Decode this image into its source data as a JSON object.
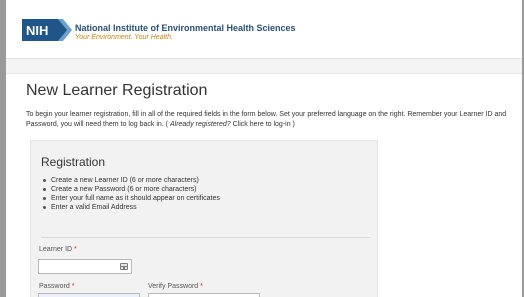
{
  "header": {
    "logo_text": "NIH",
    "org_name": "National Institute of Environmental Health Sciences",
    "tagline": "Your Environment. Your Health."
  },
  "page": {
    "title": "New Learner Registration",
    "intro_part1": "To begin your learner registration, fill in all of the required fields in the form below. Set your preferred language on the right. Remember your Learner ID and Password, you will need them to log back in. (",
    "intro_already": "Already registered?",
    "intro_part2": "Click here to log-in",
    "intro_end": ")"
  },
  "registration": {
    "title": "Registration",
    "requirements": [
      "Create a new Learner ID (6 or more characters)",
      "Create a new Password (6 or more characters)",
      "Enter your full name as it should appear on certificates",
      "Enter a valid Email Address"
    ],
    "learner_id_label": "Learner ID",
    "learner_id_value": "",
    "password_label": "Password",
    "password_value": "",
    "verify_password_label": "Verify Password",
    "verify_password_value": "",
    "required_marker": "*"
  },
  "colors": {
    "brand_blue": "#2a4f7a",
    "tagline_gold": "#c28a16",
    "required_red": "#cc2222"
  },
  "icons": {
    "logo": "nih-logo",
    "input_assist": "key-icon"
  }
}
